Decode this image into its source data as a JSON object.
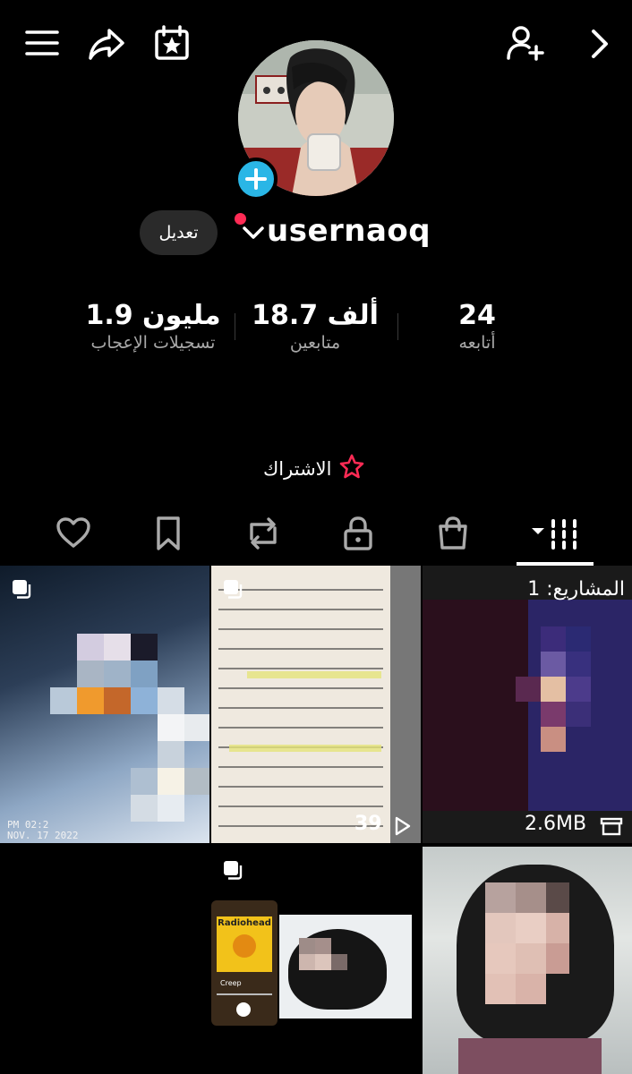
{
  "topbar": {
    "menu_icon": "hamburger-menu-icon",
    "share_icon": "share-arrow-icon",
    "calendar_icon": "calendar-star-icon",
    "add_friend_icon": "person-plus-icon",
    "next_icon": "chevron-right-icon"
  },
  "profile": {
    "username": "usernaoq",
    "edit_label": "تعديل",
    "add_badge": "+"
  },
  "stats": {
    "following_count": "24",
    "following_label": "أتابعه",
    "followers_count": "18.7 ألف",
    "followers_label": "متابعين",
    "likes_count": "1.9 مليون",
    "likes_label": "تسجيلات الإعجاب"
  },
  "subscribe": {
    "label": "الاشتراك"
  },
  "tabs": [
    {
      "icon": "grid-icon"
    },
    {
      "icon": "shopping-bag-icon"
    },
    {
      "icon": "lock-icon"
    },
    {
      "icon": "repost-icon"
    },
    {
      "icon": "bookmark-icon"
    },
    {
      "icon": "heart-icon"
    }
  ],
  "grid": {
    "projects_label": "المشاريع: 1",
    "project_size": "2.6MB",
    "post2_views": "39",
    "post1_timestamp_line1": "PM 02:2",
    "post1_timestamp_line2": "NOV. 17 2022",
    "album_title": "Radiohead",
    "song_title": "Creep"
  },
  "colors": {
    "accent_blue": "#2ab6e6",
    "notify_red": "#ff2b55",
    "muted_text": "#a8a8a8"
  }
}
